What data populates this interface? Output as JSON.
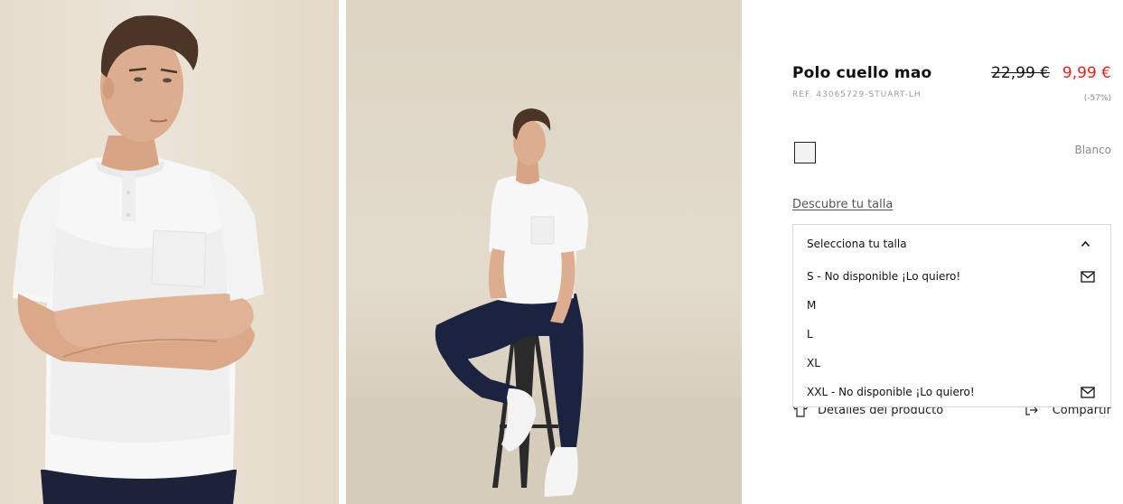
{
  "product": {
    "title": "Polo cuello mao",
    "ref": "REF. 43065729-STUART-LH",
    "old_price": "22,99 €",
    "new_price": "9,99 €",
    "discount": "(-57%)",
    "color_name": "Blanco",
    "swatch_color": "#f2f2f2",
    "size_guide": "Descubre tu talla"
  },
  "size_select": {
    "header": "Selecciona tu talla",
    "options": [
      {
        "label": "S - No disponible ¡Lo quiero!",
        "icon": "mail-icon"
      },
      {
        "label": "M"
      },
      {
        "label": "L"
      },
      {
        "label": "XL"
      },
      {
        "label": "XXL - No disponible ¡Lo quiero!",
        "icon": "mail-icon"
      }
    ]
  },
  "actions": {
    "details_label": "Detalles del producto",
    "share_label": "Compartir"
  },
  "colors": {
    "price_sale": "#e2231a",
    "text_muted": "#9a9a9a"
  }
}
